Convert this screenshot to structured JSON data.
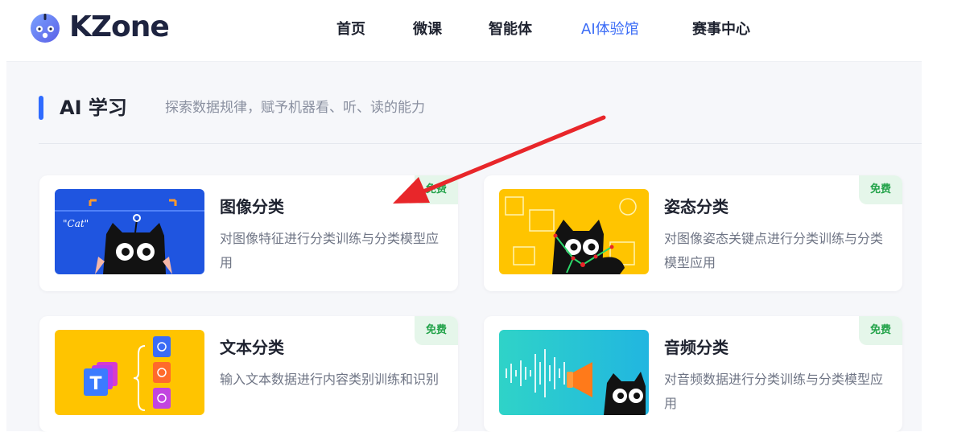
{
  "brand": {
    "name": "KZone"
  },
  "nav": {
    "items": [
      {
        "label": "首页"
      },
      {
        "label": "微课"
      },
      {
        "label": "智能体"
      },
      {
        "label": "AI体验馆"
      },
      {
        "label": "赛事中心"
      }
    ],
    "active_index": 3
  },
  "section": {
    "title": "AI 学习",
    "subtitle": "探索数据规律，赋予机器看、听、读的能力"
  },
  "cards": [
    {
      "title": "图像分类",
      "description": "对图像特征进行分类训练与分类模型应用",
      "badge": "免费",
      "thumb_text": "\"Cat\""
    },
    {
      "title": "姿态分类",
      "description": "对图像姿态关键点进行分类训练与分类模型应用",
      "badge": "免费"
    },
    {
      "title": "文本分类",
      "description": "输入文本数据进行内容类别训练和识别",
      "badge": "免费",
      "thumb_text": "T"
    },
    {
      "title": "音频分类",
      "description": "对音频数据进行分类训练与分类模型应用",
      "badge": "免费"
    }
  ],
  "colors": {
    "accent": "#3b6cf6",
    "badge_bg": "#e5f6ea",
    "badge_text": "#23a34a",
    "annotation_arrow": "#e8262a"
  },
  "icons": [
    "kzone-logo-icon",
    "red-annotation-arrow"
  ]
}
